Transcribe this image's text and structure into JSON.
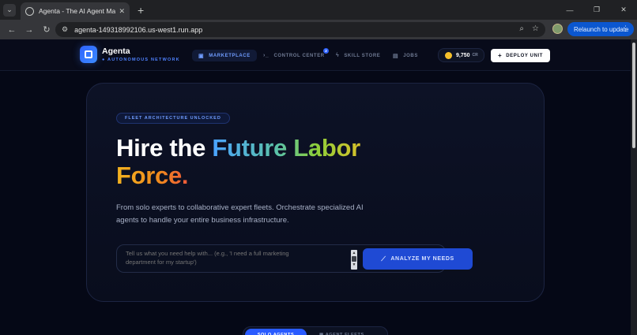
{
  "browser": {
    "tab_title": "Agenta - The AI Agent Marketplace",
    "url": "agenta-149318992106.us-west1.run.app",
    "relaunch_label": "Relaunch to update"
  },
  "header": {
    "brand": "Agenta",
    "brand_sub": "● AUTONOMOUS NETWORK",
    "nav": [
      {
        "label": "MARKETPLACE",
        "icon": "grid-icon"
      },
      {
        "label": "CONTROL CENTER",
        "icon": "terminal-icon"
      },
      {
        "label": "SKILL STORE",
        "icon": "bolt-icon"
      },
      {
        "label": "JOBS",
        "icon": "briefcase-icon"
      }
    ],
    "control_center_badge": "2",
    "credits_value": "9,750",
    "credits_unit": "CR",
    "deploy_label": "DEPLOY UNIT"
  },
  "hero": {
    "pill": "FLEET ARCHITECTURE UNLOCKED",
    "title_part1": "Hire the ",
    "title_part2": "Future Labor",
    "title_part3": "Force.",
    "description": "From solo experts to collaborative expert fleets. Orchestrate specialized AI agents to handle your entire business infrastructure.",
    "input_placeholder": "Tell us what you need help with... (e.g., 'I need a full marketing department for my startup')",
    "analyze_label": "ANALYZE MY NEEDS"
  },
  "tabs": {
    "active": "SOLO AGENTS",
    "inactive": "▦ AGENT FLEETS"
  },
  "colors": {
    "accent": "#2f63ff",
    "background": "#050816",
    "gold": "#f5c02b"
  }
}
